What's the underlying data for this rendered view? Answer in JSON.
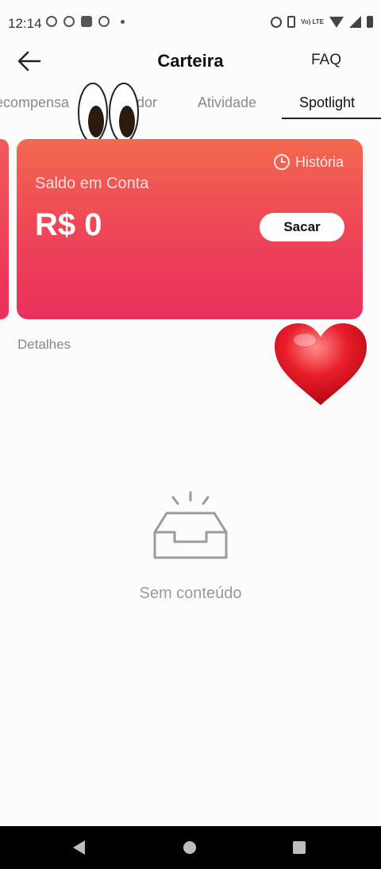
{
  "status_bar": {
    "time": "12:14",
    "network_label": "Vo) LTE"
  },
  "header": {
    "title": "Carteira",
    "faq_label": "FAQ"
  },
  "tabs": [
    {
      "label": "ecompensa",
      "active": false
    },
    {
      "label": "dor",
      "active": false
    },
    {
      "label": "Atividade",
      "active": false
    },
    {
      "label": "Spotlight",
      "active": true
    }
  ],
  "card": {
    "history_label": "História",
    "balance_label": "Saldo em Conta",
    "balance_value": "R$ 0",
    "withdraw_label": "Sacar"
  },
  "details_label": "Detalhes",
  "empty_state": {
    "text": "Sem conteúdo"
  },
  "colors": {
    "card_top": "#f3684f",
    "card_bottom": "#e9305c",
    "nav_bar": "#000000"
  }
}
